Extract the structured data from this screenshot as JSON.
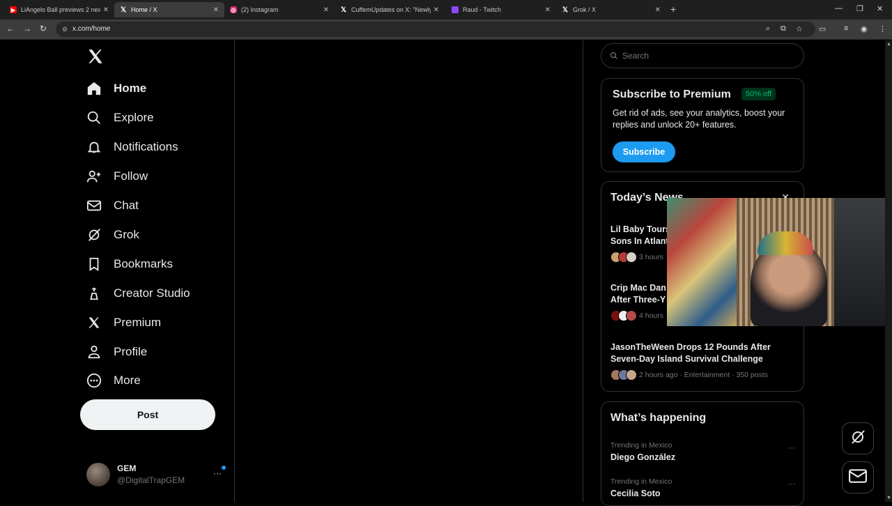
{
  "browser": {
    "tabs": [
      {
        "title": "LiAngelo Ball previews 2 new s",
        "favicon": "youtube-icon",
        "color": "#ff0000",
        "active": false
      },
      {
        "title": "Home / X",
        "favicon": "x-icon",
        "color": "#000000",
        "active": true
      },
      {
        "title": "(2) Instagram",
        "favicon": "instagram-icon",
        "color": "#d62976",
        "active": false
      },
      {
        "title": "CuffemUpdates on X: \"Newly n",
        "favicon": "x-icon",
        "color": "#000000",
        "active": false
      },
      {
        "title": "Raud - Twitch",
        "favicon": "twitch-icon",
        "color": "#9146ff",
        "active": false
      },
      {
        "title": "Grok / X",
        "favicon": "x-icon",
        "color": "#000000",
        "active": false
      }
    ],
    "url": "x.com/home"
  },
  "sidebar": {
    "items": [
      {
        "label": "Home",
        "icon": "home-icon"
      },
      {
        "label": "Explore",
        "icon": "search-icon"
      },
      {
        "label": "Notifications",
        "icon": "bell-icon"
      },
      {
        "label": "Follow",
        "icon": "follow-icon"
      },
      {
        "label": "Chat",
        "icon": "mail-icon"
      },
      {
        "label": "Grok",
        "icon": "grok-icon"
      },
      {
        "label": "Bookmarks",
        "icon": "bookmark-icon"
      },
      {
        "label": "Creator Studio",
        "icon": "creator-studio-icon"
      },
      {
        "label": "Premium",
        "icon": "x-icon"
      },
      {
        "label": "Profile",
        "icon": "profile-icon"
      },
      {
        "label": "More",
        "icon": "more-icon"
      }
    ],
    "post_label": "Post",
    "account": {
      "name": "GEM",
      "handle": "@DigitalTrapGEM",
      "more": "···"
    }
  },
  "right": {
    "search_placeholder": "Search",
    "premium": {
      "title": "Subscribe to Premium",
      "badge": "50% off",
      "text": "Get rid of ads, see your analytics, boost your replies and unlock 20+ features.",
      "button": "Subscribe"
    },
    "news": {
      "title": "Today’s News",
      "close": "✕",
      "items": [
        {
          "headline": "Lil Baby Tours\nSons In Atlant",
          "meta": "3 hours"
        },
        {
          "headline": "Crip Mac Dan\nAfter Three-Y",
          "meta": "4 hours"
        },
        {
          "headline": "JasonTheWeen Drops 12 Pounds After Seven-Day Island Survival Challenge",
          "meta": "2 hours ago · Entertainment · 350 posts"
        }
      ]
    },
    "happening": {
      "title": "What’s happening",
      "trends": [
        {
          "context": "Trending in Mexico",
          "name": "Diego González",
          "more": "···"
        },
        {
          "context": "Trending in Mexico",
          "name": "Cecilia Soto",
          "more": "···"
        }
      ]
    }
  },
  "colors": {
    "accent": "#1d9bf0",
    "badge_text": "#00ba7c",
    "border": "#2f3336",
    "muted": "#71767b"
  }
}
